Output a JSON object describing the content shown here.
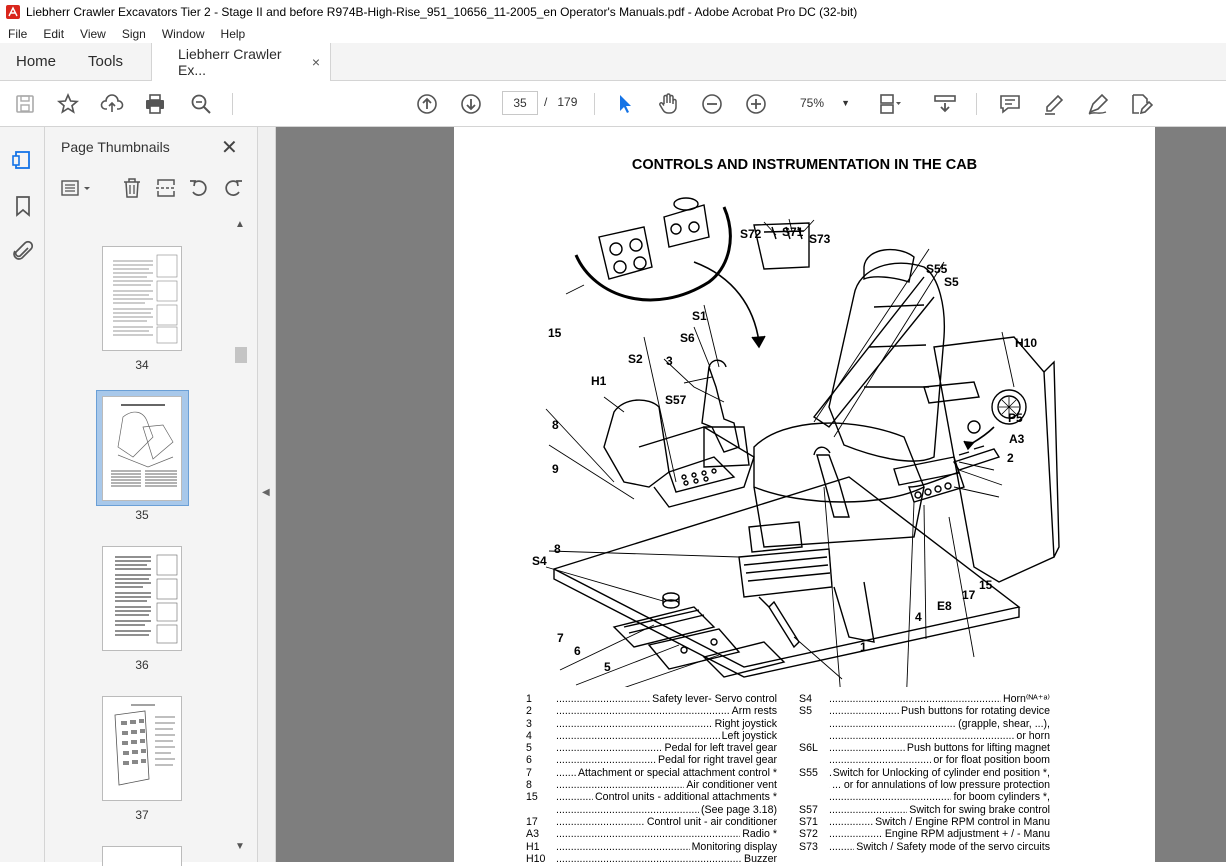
{
  "window": {
    "title": "Liebherr Crawler Excavators Tier 2 - Stage II and before R974B-High-Rise_951_10656_11-2005_en Operator's Manuals.pdf - Adobe Acrobat Pro DC (32-bit)"
  },
  "menu": [
    "File",
    "Edit",
    "View",
    "Sign",
    "Window",
    "Help"
  ],
  "tabs": {
    "home": "Home",
    "tools": "Tools",
    "document": "Liebherr Crawler Ex...",
    "close_glyph": "×"
  },
  "toolbar": {
    "current_page": "35",
    "separator": "/",
    "total_pages": "179",
    "zoom": "75%",
    "icons": [
      "save-icon",
      "star-icon",
      "upload-icon",
      "print-icon",
      "search-zoom-icon",
      "page-up-icon",
      "page-down-icon",
      "select-arrow-icon",
      "hand-icon",
      "zoom-out-icon",
      "zoom-in-icon",
      "page-fit-icon",
      "scroll-mode-icon",
      "comment-icon",
      "highlight-icon",
      "sign-icon",
      "edit-pdf-icon"
    ]
  },
  "thumbnails": {
    "title": "Page Thumbnails",
    "close_glyph": "✕",
    "pages": [
      {
        "num": "34",
        "selected": false
      },
      {
        "num": "35",
        "selected": true
      },
      {
        "num": "36",
        "selected": false
      },
      {
        "num": "37",
        "selected": false
      }
    ]
  },
  "document": {
    "title": "CONTROLS AND INSTRUMENTATION IN THE CAB",
    "callouts": [
      "S72",
      "S71",
      "S73",
      "S55",
      "S5",
      "15",
      "S1",
      "S6",
      "H10",
      "S2",
      "3",
      "H1",
      "S57",
      "P5",
      "A3",
      "2",
      "8",
      "9",
      "8",
      "S4",
      "15",
      "17",
      "E8",
      "4",
      "1",
      "7",
      "6",
      "5"
    ],
    "legend_left": [
      {
        "key": "1",
        "text": "Safety lever- Servo control"
      },
      {
        "key": "2",
        "text": "Arm rests"
      },
      {
        "key": "3",
        "text": "Right joystick"
      },
      {
        "key": "4",
        "text": "Left joystick"
      },
      {
        "key": "5",
        "text": "Pedal for left travel gear"
      },
      {
        "key": "6",
        "text": "Pedal for right travel gear"
      },
      {
        "key": "7",
        "text": "Attachment or special attachment control *"
      },
      {
        "key": "8",
        "text": "Air conditioner vent"
      },
      {
        "key": "15",
        "text": "Control units - additional attachments *"
      },
      {
        "key": "",
        "text": "(See page 3.18)"
      },
      {
        "key": "17",
        "text": "Control unit - air conditioner"
      },
      {
        "key": "A3",
        "text": "Radio *"
      },
      {
        "key": "H1",
        "text": "Monitoring display"
      },
      {
        "key": "H10",
        "text": "Buzzer"
      }
    ],
    "legend_right": [
      {
        "key": "S4",
        "text": "Horn⁽ᴺᴬ⁺ᵃ⁾"
      },
      {
        "key": "S5",
        "text": "Push buttons for rotating device"
      },
      {
        "key": "",
        "text": "(grapple,  shear, ...),"
      },
      {
        "key": "",
        "text": "or horn"
      },
      {
        "key": "S6L",
        "text": "Push buttons for lifting magnet"
      },
      {
        "key": "",
        "text": "or for float position boom"
      },
      {
        "key": "S55",
        "text": "Switch for Unlocking of cylinder end position *,"
      },
      {
        "key": "",
        "text": "... or for annulations of low pressure protection"
      },
      {
        "key": "",
        "text": "for boom cylinders  *,"
      },
      {
        "key": "S57",
        "text": "Switch for swing brake control"
      },
      {
        "key": "S71",
        "text": "Switch / Engine RPM control in Manu"
      },
      {
        "key": "S72",
        "text": "Engine RPM adjustment + / - Manu"
      },
      {
        "key": "S73",
        "text": "Switch / Safety mode of the servo circuits"
      }
    ]
  },
  "colors": {
    "viewer_bg": "#7e7e7e",
    "panel_bg": "#f4f4f4",
    "selected_thumb": "#a8c8ea",
    "acrobat_red": "#d9261c"
  }
}
